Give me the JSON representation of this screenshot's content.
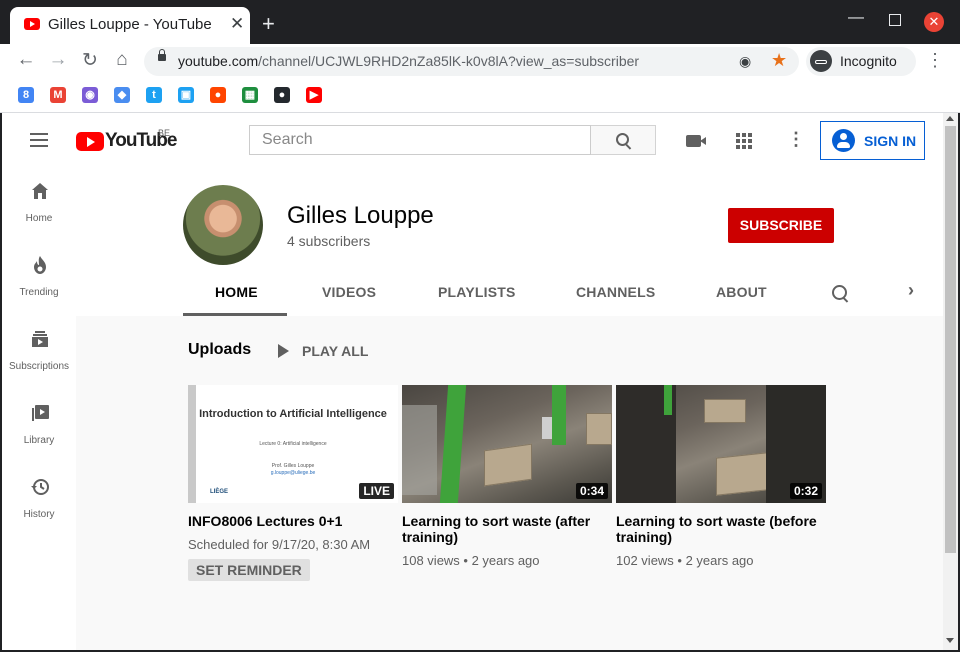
{
  "browser": {
    "tab_title": "Gilles Louppe - YouTube",
    "tab_close": "✕",
    "new_tab": "+",
    "url_host": "youtube.com",
    "url_path": "/channel/UCJWL9RHD2nZa85lK-k0v8lA?view_as=subscriber",
    "incognito_label": "Incognito",
    "nav_icons": [
      "back-icon",
      "forward-icon",
      "reload-icon",
      "home-icon"
    ],
    "bookmarks": [
      {
        "name": "google-calendar",
        "color": "#4285f4",
        "glyph": "8"
      },
      {
        "name": "gmail",
        "color": "#ea4335",
        "glyph": "M"
      },
      {
        "name": "bookmark-purple",
        "color": "#7b5cd6",
        "glyph": "◉"
      },
      {
        "name": "bookmark-blue",
        "color": "#4a8df0",
        "glyph": "◆"
      },
      {
        "name": "twitter",
        "color": "#1da1f2",
        "glyph": "t"
      },
      {
        "name": "tweetdeck",
        "color": "#1da1f2",
        "glyph": "▣"
      },
      {
        "name": "reddit",
        "color": "#ff4500",
        "glyph": "●"
      },
      {
        "name": "bookmark-green",
        "color": "#1e8e3e",
        "glyph": "▦"
      },
      {
        "name": "github",
        "color": "#24292e",
        "glyph": "●"
      },
      {
        "name": "youtube",
        "color": "#ff0000",
        "glyph": "▶"
      }
    ]
  },
  "yt": {
    "logo_text": "YouTube",
    "region": "BE",
    "search_placeholder": "Search",
    "sign_in": "SIGN IN"
  },
  "sidebar": {
    "items": [
      {
        "label": "Home",
        "icon": "home-icon"
      },
      {
        "label": "Trending",
        "icon": "fire-icon"
      },
      {
        "label": "Subscriptions",
        "icon": "subscriptions-icon"
      },
      {
        "label": "Library",
        "icon": "library-icon"
      },
      {
        "label": "History",
        "icon": "history-icon"
      }
    ]
  },
  "channel": {
    "name": "Gilles Louppe",
    "subscribers": "4 subscribers",
    "subscribe_label": "SUBSCRIBE",
    "tabs": [
      "HOME",
      "VIDEOS",
      "PLAYLISTS",
      "CHANNELS",
      "ABOUT"
    ],
    "active_tab": "HOME"
  },
  "uploads": {
    "heading": "Uploads",
    "play_all": "PLAY ALL",
    "videos": [
      {
        "title": "INFO8006 Lectures 0+1",
        "badge": "LIVE",
        "meta": "Scheduled for 9/17/20, 8:30 AM",
        "action": "SET REMINDER",
        "slide_title": "Introduction to Artificial Intelligence",
        "slide_sub": "Lecture 0: Artificial intelligence",
        "slide_author": "Prof. Gilles Louppe",
        "slide_email": "g.louppe@uliege.be",
        "slide_logo": "LIÈGE"
      },
      {
        "title": "Learning to sort waste (after training)",
        "badge": "0:34",
        "meta": "108 views • 2 years ago"
      },
      {
        "title": "Learning to sort waste (before training)",
        "badge": "0:32",
        "meta": "102 views • 2 years ago"
      }
    ]
  }
}
